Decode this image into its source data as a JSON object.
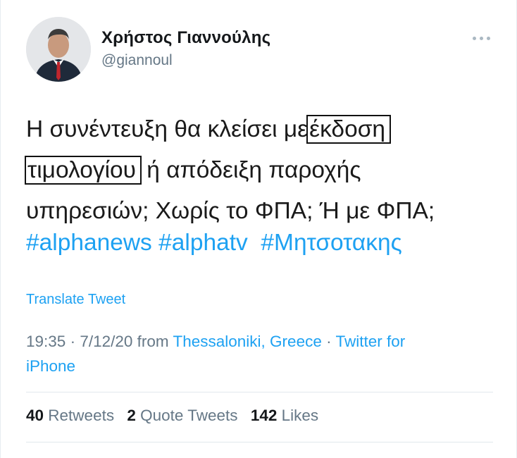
{
  "author": {
    "display_name": "Χρήστος Γιαννούλης",
    "handle": "@giannoul"
  },
  "tweet": {
    "line1_pre": "Η συνέντευξη θα κλείσει με",
    "line1_boxed": "έκδοση",
    "line2_boxed": "τιμολογίου",
    "line2_post": " ή απόδειξη παροχής",
    "line3": "υπηρεσιών; Χωρίς το ΦΠΑ; Ή με ΦΠΑ;",
    "hashtags": [
      "#alphanews",
      "#alphatv",
      "#Μητσοτακης"
    ]
  },
  "translate_label": "Translate Tweet",
  "meta": {
    "time": "19:35",
    "sep1": " · ",
    "date": "7/12/20",
    "from": " from ",
    "location": "Thessaloniki, Greece",
    "sep2": " · ",
    "source_part1": "Twitter for",
    "source_part2": "iPhone"
  },
  "stats": {
    "retweets_count": "40",
    "retweets_label": "Retweets",
    "quotes_count": "2",
    "quotes_label": "Quote Tweets",
    "likes_count": "142",
    "likes_label": "Likes"
  },
  "colors": {
    "accent": "#1da1f2",
    "muted": "#657786",
    "text": "#14171a"
  },
  "icons": {
    "more": "more-horizontal-icon"
  }
}
